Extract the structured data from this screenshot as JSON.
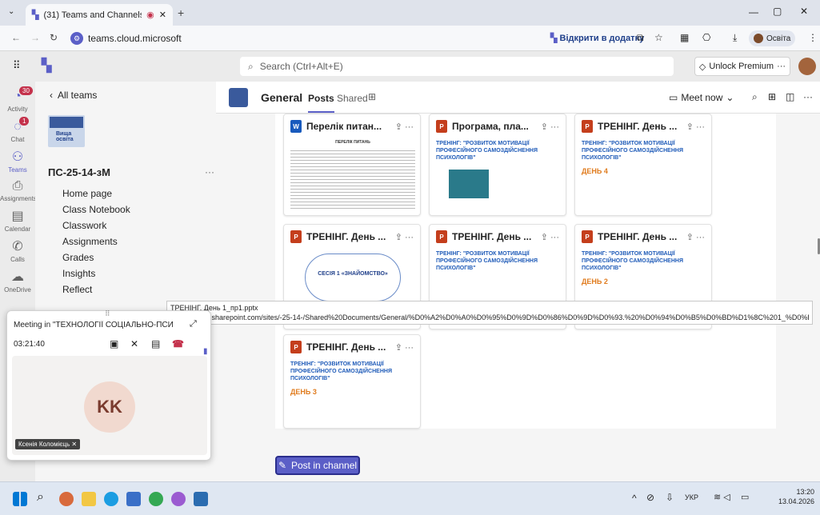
{
  "browser": {
    "tab_title": "(31) Teams and Channels | ",
    "url": "teams.cloud.microsoft",
    "open_in_app": "Відкрити в додатку",
    "profile_label": "Освіта"
  },
  "teams": {
    "search_placeholder": "Search (Ctrl+Alt+E)",
    "unlock_premium": "Unlock Premium"
  },
  "rail": [
    {
      "label": "Activity",
      "icon": "bell-icon",
      "badge": "30"
    },
    {
      "label": "Chat",
      "icon": "chat-icon",
      "badge": "1"
    },
    {
      "label": "Teams",
      "icon": "teams-icon",
      "badge": ""
    },
    {
      "label": "Assignments",
      "icon": "assignments-icon",
      "badge": ""
    },
    {
      "label": "Calendar",
      "icon": "calendar-icon",
      "badge": ""
    },
    {
      "label": "Calls",
      "icon": "calls-icon",
      "badge": ""
    },
    {
      "label": "OneDrive",
      "icon": "onedrive-icon",
      "badge": ""
    }
  ],
  "team": {
    "back_label": "All teams",
    "logo_text": "Вища освіта",
    "name": "ПС-25-14-зМ",
    "items": [
      "Home page",
      "Class Notebook",
      "Classwork",
      "Assignments",
      "Grades",
      "Insights",
      "Reflect"
    ]
  },
  "channel": {
    "name": "General",
    "tabs": [
      "Posts",
      "Shared"
    ],
    "meet_now": "Meet now"
  },
  "cards": [
    {
      "type": "doc",
      "title": "Перелік питан...",
      "preview_title": "ПЕРЕЛІК ПИТАНЬ",
      "day": ""
    },
    {
      "type": "ppt",
      "title": "Програма, пла...",
      "preview_title": "ТРЕНІНГ: \"РОЗВИТОК МОТИВАЦІЇ ПРОФЕСІЙНОГО САМОЗДІЙСНЕННЯ ПСИХОЛОГІВ\"",
      "day": ""
    },
    {
      "type": "ppt",
      "title": "ТРЕНІНГ. День ...",
      "preview_title": "ТРЕНІНГ: \"РОЗВИТОК МОТИВАЦІЇ ПРОФЕСІЙНОГО САМОЗДІЙСНЕННЯ ПСИХОЛОГІВ\"",
      "day": "ДЕНЬ 4"
    },
    {
      "type": "ppt",
      "title": "ТРЕНІНГ. День ...",
      "preview_title": "СЕСІЯ 1 «ЗНАЙОМСТВО»",
      "day": ""
    },
    {
      "type": "ppt",
      "title": "ТРЕНІНГ. День ...",
      "preview_title": "ТРЕНІНГ: \"РОЗВИТОК МОТИВАЦІЇ ПРОФЕСІЙНОГО САМОЗДІЙСНЕННЯ ПСИХОЛОГІВ\"",
      "day": ""
    },
    {
      "type": "ppt",
      "title": "ТРЕНІНГ. День ...",
      "preview_title": "ТРЕНІНГ: \"РОЗВИТОК МОТИВАЦІЇ ПРОФЕСІЙНОГО САМОЗДІЙСНЕННЯ ПСИХОЛОГІВ\"",
      "day": "ДЕНЬ 2"
    },
    {
      "type": "ppt",
      "title": "ТРЕНІНГ. День ...",
      "preview_title": "ТРЕНІНГ: \"РОЗВИТОК МОТИВАЦІЇ ПРОФЕСІЙНОГО САМОЗДІЙСНЕННЯ ПСИХОЛОГІВ\"",
      "day": "ДЕНЬ 3"
    }
  ],
  "tooltip": {
    "filename": "ТРЕНІНГ. День 1_пр1.pptx",
    "url": "https://binpo.sharepoint.com/sites/-25-14-/Shared%20Documents/General/%D0%A2%D0%A0%D0%95%D0%9D%D0%86%D0%9D%D0%93.%20%D0%94%D0%B5%D0%BD%D1%8C%201_%D0%BF%D1%801.pptx"
  },
  "meeting": {
    "title": "Meeting in \"ТЕХНОЛОГІЇ СОЦІАЛЬНО-ПСИХ...",
    "timer": "03:21:40",
    "initials": "KK",
    "participant": "Ксенія Коломієць"
  },
  "post_button": "Post in channel",
  "taskbar": {
    "lang": "УКР",
    "time": "13:20",
    "date": "13.04.2026"
  },
  "colors": {
    "accent": "#5b5fc7",
    "ppt": "#c43e1c",
    "doc": "#185abd",
    "badge": "#c4314b",
    "hangup": "#c4314b"
  }
}
